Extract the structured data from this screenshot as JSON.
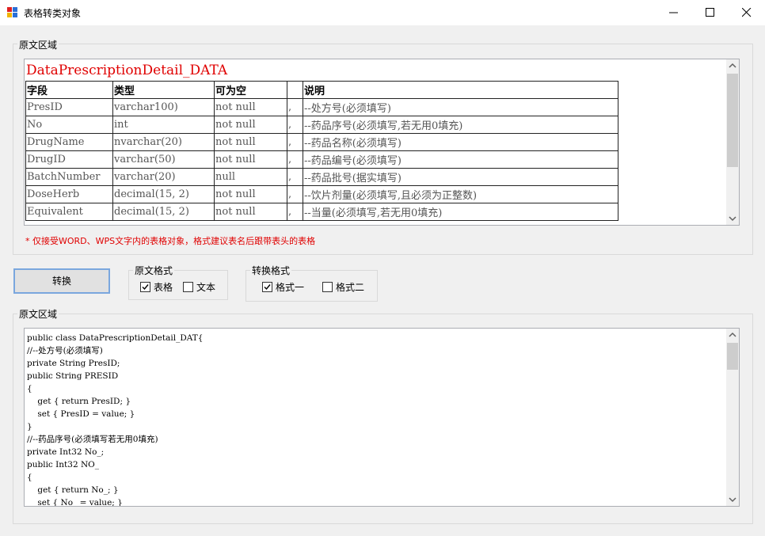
{
  "window": {
    "title": "表格转类对象",
    "min_icon": "minimize-icon",
    "max_icon": "maximize-icon",
    "close_icon": "close-icon"
  },
  "source_group": {
    "label": "原文区域",
    "doc_title": "DataPrescriptionDetail_DATA",
    "headers": [
      "字段",
      "类型",
      "可为空",
      "",
      "说明"
    ],
    "rows": [
      [
        "PresID",
        "varchar100)",
        "not null",
        ",",
        "--处方号(必须填写)"
      ],
      [
        "No",
        "int",
        "not null",
        ",",
        "--药品序号(必须填写,若无用0填充)"
      ],
      [
        "DrugName",
        "nvarchar(20)",
        "not null",
        ",",
        "--药品名称(必须填写)"
      ],
      [
        "DrugID",
        "varchar(50)",
        "not null",
        ",",
        "--药品编号(必须填写)"
      ],
      [
        "BatchNumber",
        "varchar(20)",
        "null",
        ",",
        "--药品批号(据实填写)"
      ],
      [
        "DoseHerb",
        "decimal(15, 2)",
        "not null",
        ",",
        "--饮片剂量(必须填写,且必须为正整数)"
      ],
      [
        "Equivalent",
        "decimal(15, 2)",
        "not null",
        ",",
        "--当量(必须填写,若无用0填充)"
      ]
    ],
    "note": "* 仅接受WORD、WPS文字内的表格对象，格式建议表名后跟带表头的表格"
  },
  "convert_button": "转换",
  "source_format": {
    "label": "原文格式",
    "table": "表格",
    "text": "文本",
    "table_checked": true,
    "text_checked": false
  },
  "target_format": {
    "label": "转换格式",
    "format1": "格式一",
    "format2": "格式二",
    "format1_checked": true,
    "format2_checked": false
  },
  "output_group": {
    "label": "原文区域",
    "code": "public class DataPrescriptionDetail_DAT{\n//--处方号(必须填写)\nprivate String PresID;\npublic String PRESID\n{\n    get { return PresID; }\n    set { PresID = value; }\n}\n//--药品序号(必须填写若无用0填充)\nprivate Int32 No_;\npublic Int32 NO_\n{\n    get { return No_; }\n    set { No_ = value; }"
  },
  "colors": {
    "accent": "#0078d7",
    "note_red": "#e00000",
    "button_border": "#7aa7de"
  }
}
